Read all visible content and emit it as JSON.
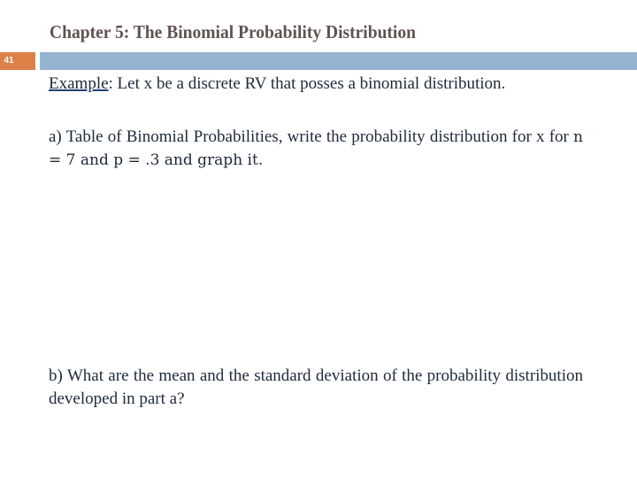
{
  "slide": {
    "title": "Chapter 5: The Binomial Probability Distribution",
    "page_number": "41",
    "colors": {
      "title": "#5f5350",
      "page_number_bg": "#dd8047",
      "header_bar": "#94b3d1",
      "body_text": "#1d2a3a"
    }
  },
  "content": {
    "example_label": "Example",
    "intro_rest": ": Let x be a discrete RV that posses a binomial distribution.",
    "part_a_prefix": "a) Table of Binomial Probabilities, write the probability distribution for x for ",
    "part_a_math": "   n = 7 and p = .3 and graph it.",
    "part_b": "b) What are the mean and the standard deviation of the probability distribution developed in part a?"
  }
}
